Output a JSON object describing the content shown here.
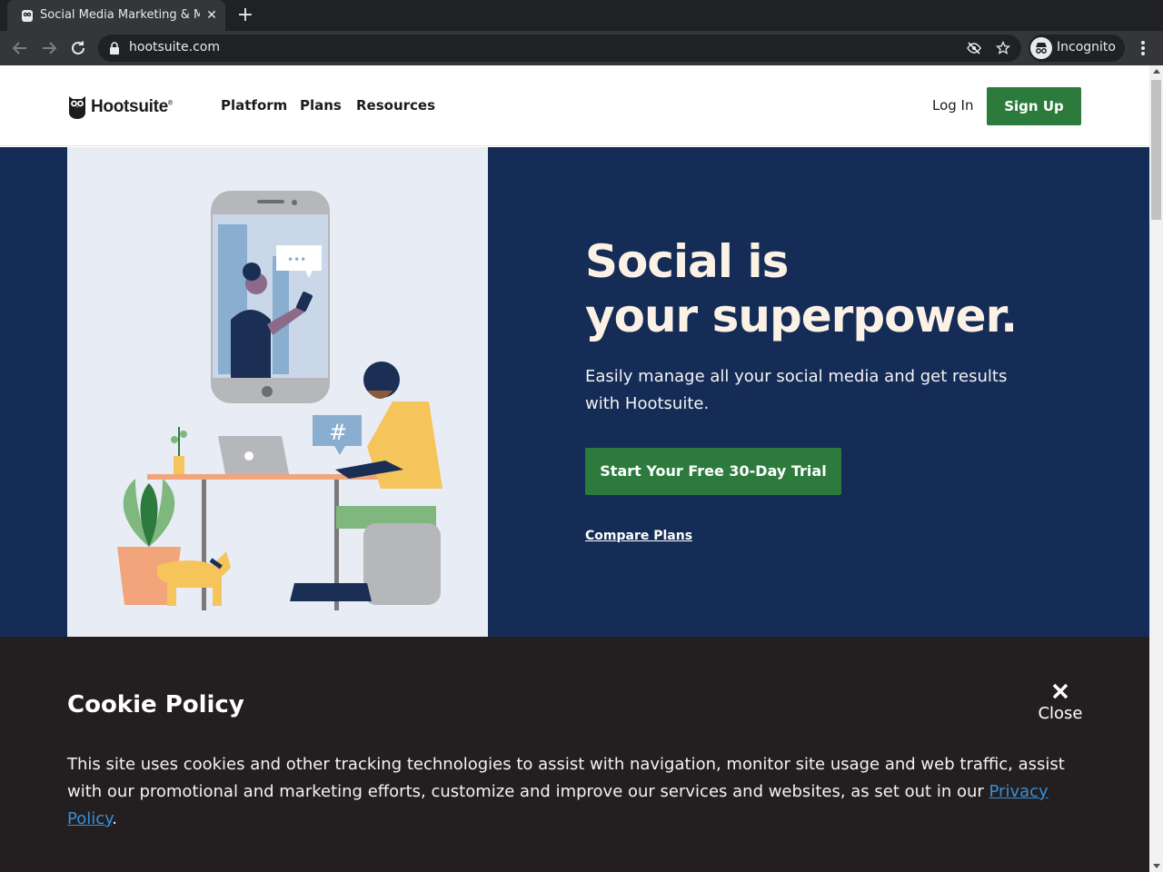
{
  "browser": {
    "tab_title": "Social Media Marketing & Management Dashboard",
    "tab_close_icon": "close-icon",
    "new_tab_icon": "plus-icon",
    "url": "hootsuite.com",
    "incognito_label": "Incognito"
  },
  "header": {
    "logo_text": "Hootsuite",
    "logo_mark": "®",
    "nav": [
      {
        "label": "Platform"
      },
      {
        "label": "Plans"
      },
      {
        "label": "Resources"
      }
    ],
    "login_label": "Log In",
    "signup_label": "Sign Up"
  },
  "hero": {
    "title_line1": "Social is",
    "title_line2": "your superpower.",
    "subtitle": "Easily manage all your social media and get results with Hootsuite.",
    "cta_label": "Start Your Free 30-Day Trial",
    "compare_label": "Compare Plans",
    "art_hashtag": "#",
    "art_chat": "•••"
  },
  "cookie": {
    "title": "Cookie Policy",
    "close_label": "Close",
    "text": "This site uses cookies and other tracking technologies to assist with navigation, monitor site usage and web traffic, assist with our promotional and marketing efforts, customize and improve our services and websites, as set out in our ",
    "link_label": "Privacy Policy",
    "text_end": "."
  },
  "colors": {
    "brand_green": "#2d7b3c",
    "hero_navy": "#152c57",
    "cookie_bg": "#231f20",
    "link_blue": "#3a8ed4"
  }
}
